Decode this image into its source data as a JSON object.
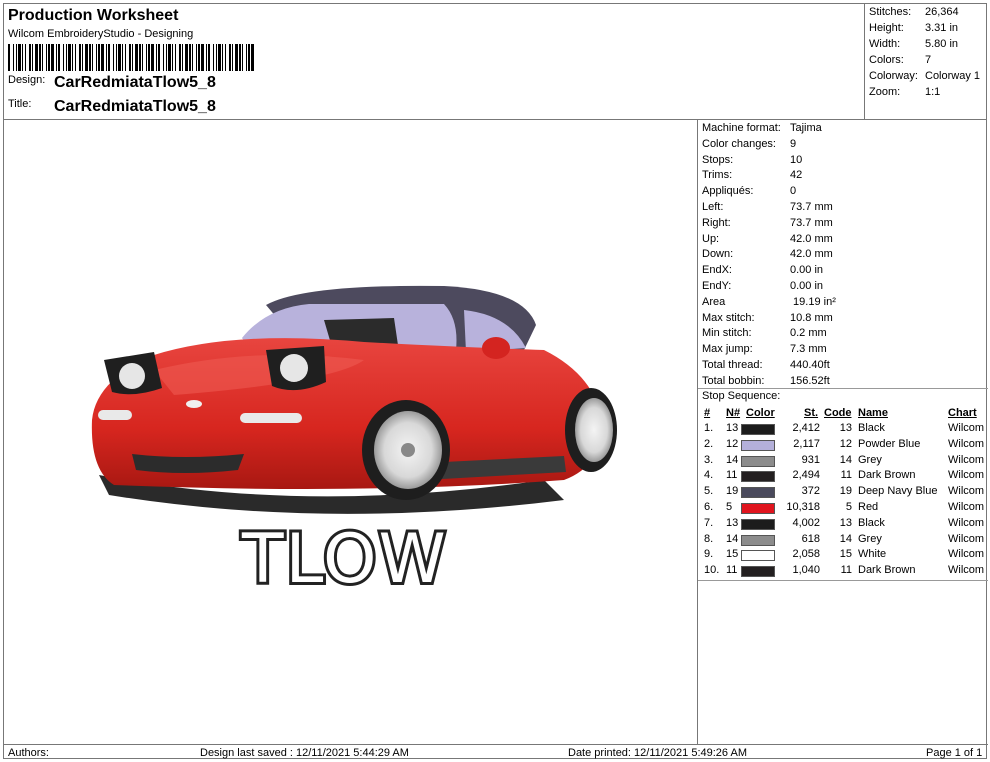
{
  "header": {
    "title": "Production Worksheet",
    "subtitle": "Wilcom EmbroideryStudio - Designing",
    "design_label": "Design:",
    "design_value": "CarRedmiataTlow5_8",
    "title_label": "Title:",
    "title_value": "CarRedmiataTlow5_8"
  },
  "stats": [
    {
      "k": "Stitches:",
      "v": "26,364"
    },
    {
      "k": "Height:",
      "v": "3.31 in"
    },
    {
      "k": "Width:",
      "v": "5.80 in"
    },
    {
      "k": "Colors:",
      "v": "7"
    },
    {
      "k": "Colorway:",
      "v": "Colorway 1"
    },
    {
      "k": "Zoom:",
      "v": "1:1"
    }
  ],
  "info": [
    {
      "k": "Machine format:",
      "v": "Tajima"
    },
    {
      "k": "Color changes:",
      "v": "9"
    },
    {
      "k": "Stops:",
      "v": "10"
    },
    {
      "k": "Trims:",
      "v": "42"
    },
    {
      "k": "Appliqués:",
      "v": "0"
    },
    {
      "k": "Left:",
      "v": "73.7 mm"
    },
    {
      "k": "Right:",
      "v": "73.7 mm"
    },
    {
      "k": "Up:",
      "v": "42.0 mm"
    },
    {
      "k": "Down:",
      "v": "42.0 mm"
    },
    {
      "k": "EndX:",
      "v": "0.00 in"
    },
    {
      "k": "EndY:",
      "v": "0.00 in"
    },
    {
      "k": "Area",
      "v": " 19.19 in²"
    },
    {
      "k": "Max stitch:",
      "v": "10.8 mm"
    },
    {
      "k": "Min stitch:",
      "v": "0.2 mm"
    },
    {
      "k": "Max jump:",
      "v": "7.3 mm"
    },
    {
      "k": "Total thread:",
      "v": "440.40ft"
    },
    {
      "k": "Total bobbin:",
      "v": "156.52ft"
    }
  ],
  "sequence": {
    "heading": "Stop Sequence:",
    "columns": {
      "num": "#",
      "n": "N#",
      "color": "Color",
      "st": "St.",
      "code": "Code",
      "name": "Name",
      "chart": "Chart"
    },
    "rows": [
      {
        "num": "1.",
        "n": "13",
        "hex": "#1c1c1c",
        "st": "2,412",
        "code": "13",
        "name": "Black",
        "chart": "Wilcom"
      },
      {
        "num": "2.",
        "n": "12",
        "hex": "#b4b0da",
        "st": "2,117",
        "code": "12",
        "name": "Powder Blue",
        "chart": "Wilcom"
      },
      {
        "num": "3.",
        "n": "14",
        "hex": "#8c8c8c",
        "st": "931",
        "code": "14",
        "name": "Grey",
        "chart": "Wilcom"
      },
      {
        "num": "4.",
        "n": "11",
        "hex": "#231f20",
        "st": "2,494",
        "code": "11",
        "name": "Dark Brown",
        "chart": "Wilcom"
      },
      {
        "num": "5.",
        "n": "19",
        "hex": "#4a4a5c",
        "st": "372",
        "code": "19",
        "name": "Deep Navy Blue",
        "chart": "Wilcom"
      },
      {
        "num": "6.",
        "n": "5",
        "hex": "#e0141e",
        "st": "10,318",
        "code": "5",
        "name": "Red",
        "chart": "Wilcom"
      },
      {
        "num": "7.",
        "n": "13",
        "hex": "#1c1c1c",
        "st": "4,002",
        "code": "13",
        "name": "Black",
        "chart": "Wilcom"
      },
      {
        "num": "8.",
        "n": "14",
        "hex": "#8c8c8c",
        "st": "618",
        "code": "14",
        "name": "Grey",
        "chart": "Wilcom"
      },
      {
        "num": "9.",
        "n": "15",
        "hex": "#ffffff",
        "st": "2,058",
        "code": "15",
        "name": "White",
        "chart": "Wilcom"
      },
      {
        "num": "10.",
        "n": "11",
        "hex": "#231f20",
        "st": "1,040",
        "code": "11",
        "name": "Dark Brown",
        "chart": "Wilcom"
      }
    ]
  },
  "preview": {
    "embroidered_text": "TLOW"
  },
  "footer": {
    "authors": "Authors:",
    "last_saved": "Design last saved : 12/11/2021 5:44:29 AM",
    "printed": "Date printed: 12/11/2021 5:49:26 AM",
    "page": "Page 1 of 1"
  }
}
